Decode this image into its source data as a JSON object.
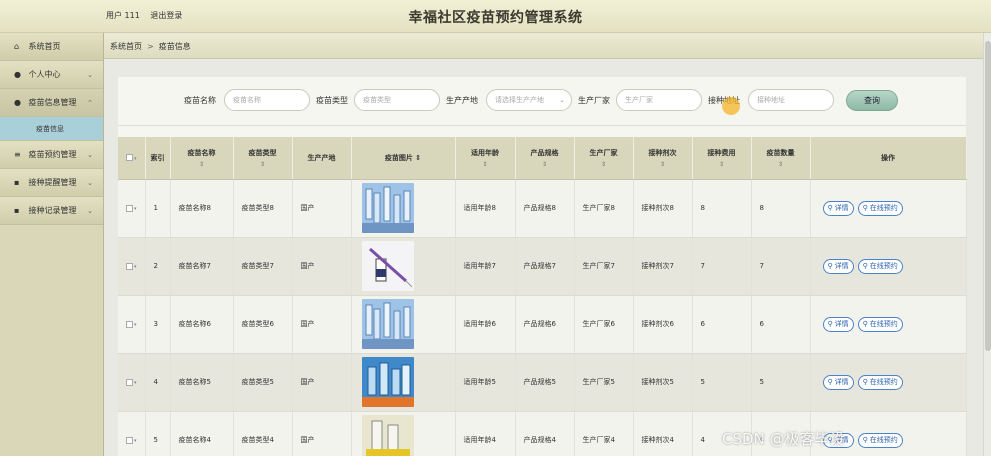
{
  "header": {
    "user_text": "用户 111",
    "logout": "退出登录",
    "title": "幸福社区疫苗预约管理系统"
  },
  "sidebar": {
    "items": [
      {
        "label": "系统首页",
        "icon": "home-icon",
        "glyph": "⌂",
        "has_chevron": false
      },
      {
        "label": "个人中心",
        "icon": "user-icon",
        "glyph": "●",
        "has_chevron": true
      },
      {
        "label": "疫苗信息管理",
        "icon": "pin-icon",
        "glyph": "●",
        "has_chevron": true
      },
      {
        "label": "疫苗预约管理",
        "icon": "sliders-icon",
        "glyph": "≡",
        "has_chevron": true
      },
      {
        "label": "接种提醒管理",
        "icon": "grid-icon",
        "glyph": "▪",
        "has_chevron": true
      },
      {
        "label": "接种记录管理",
        "icon": "grid-icon",
        "glyph": "▪",
        "has_chevron": true
      }
    ],
    "subitem": "疫苗信息"
  },
  "breadcrumb": {
    "home": "系统首页",
    "sep": ">",
    "current": "疫苗信息"
  },
  "search": {
    "name_label": "疫苗名称",
    "name_placeholder": "疫苗名称",
    "type_label": "疫苗类型",
    "type_placeholder": "疫苗类型",
    "origin_label": "生产产地",
    "origin_placeholder": "请选择生产产地",
    "maker_label": "生产厂家",
    "maker_placeholder": "生产厂家",
    "site_label": "接种地址",
    "site_placeholder": "接种地址",
    "button": "查询"
  },
  "table": {
    "headers": [
      "索引",
      "疫苗名称",
      "疫苗类型",
      "生产产地",
      "疫苗图片",
      "适用年龄",
      "产品规格",
      "生产厂家",
      "接种剂次",
      "接种费用",
      "疫苗数量",
      "操作"
    ],
    "sort_glyph": "⇕",
    "rows": [
      {
        "idx": "1",
        "name": "疫苗名称8",
        "type": "疫苗类型8",
        "origin": "国产",
        "age": "适用年龄8",
        "spec": "产品规格8",
        "maker": "生产厂家8",
        "dose": "接种剂次8",
        "fee": "8",
        "qty": "8",
        "img": "vials"
      },
      {
        "idx": "2",
        "name": "疫苗名称7",
        "type": "疫苗类型7",
        "origin": "国产",
        "age": "适用年龄7",
        "spec": "产品规格7",
        "maker": "生产厂家7",
        "dose": "接种剂次7",
        "fee": "7",
        "qty": "7",
        "img": "syringe"
      },
      {
        "idx": "3",
        "name": "疫苗名称6",
        "type": "疫苗类型6",
        "origin": "国产",
        "age": "适用年龄6",
        "spec": "产品规格6",
        "maker": "生产厂家6",
        "dose": "接种剂次6",
        "fee": "6",
        "qty": "6",
        "img": "vials"
      },
      {
        "idx": "4",
        "name": "疫苗名称5",
        "type": "疫苗类型5",
        "origin": "国产",
        "age": "适用年龄5",
        "spec": "产品规格5",
        "maker": "生产厂家5",
        "dose": "接种剂次5",
        "fee": "5",
        "qty": "5",
        "img": "bottles"
      },
      {
        "idx": "5",
        "name": "疫苗名称4",
        "type": "疫苗类型4",
        "origin": "国产",
        "age": "适用年龄4",
        "spec": "产品规格4",
        "maker": "生产厂家4",
        "dose": "接种剂次4",
        "fee": "4",
        "qty": "4",
        "img": "yellow"
      }
    ],
    "detail_label": "详情",
    "book_label": "在线预约"
  },
  "watermark": "CSDN @极客毕设",
  "colors": {
    "topbar": "#e9e7c9",
    "sidebar": "#d9d7b8",
    "submenu_active": "#a9cfd8",
    "table_header": "#d8d6bb",
    "action_blue": "#4b82c8",
    "search_button": "#9fc6b4"
  }
}
